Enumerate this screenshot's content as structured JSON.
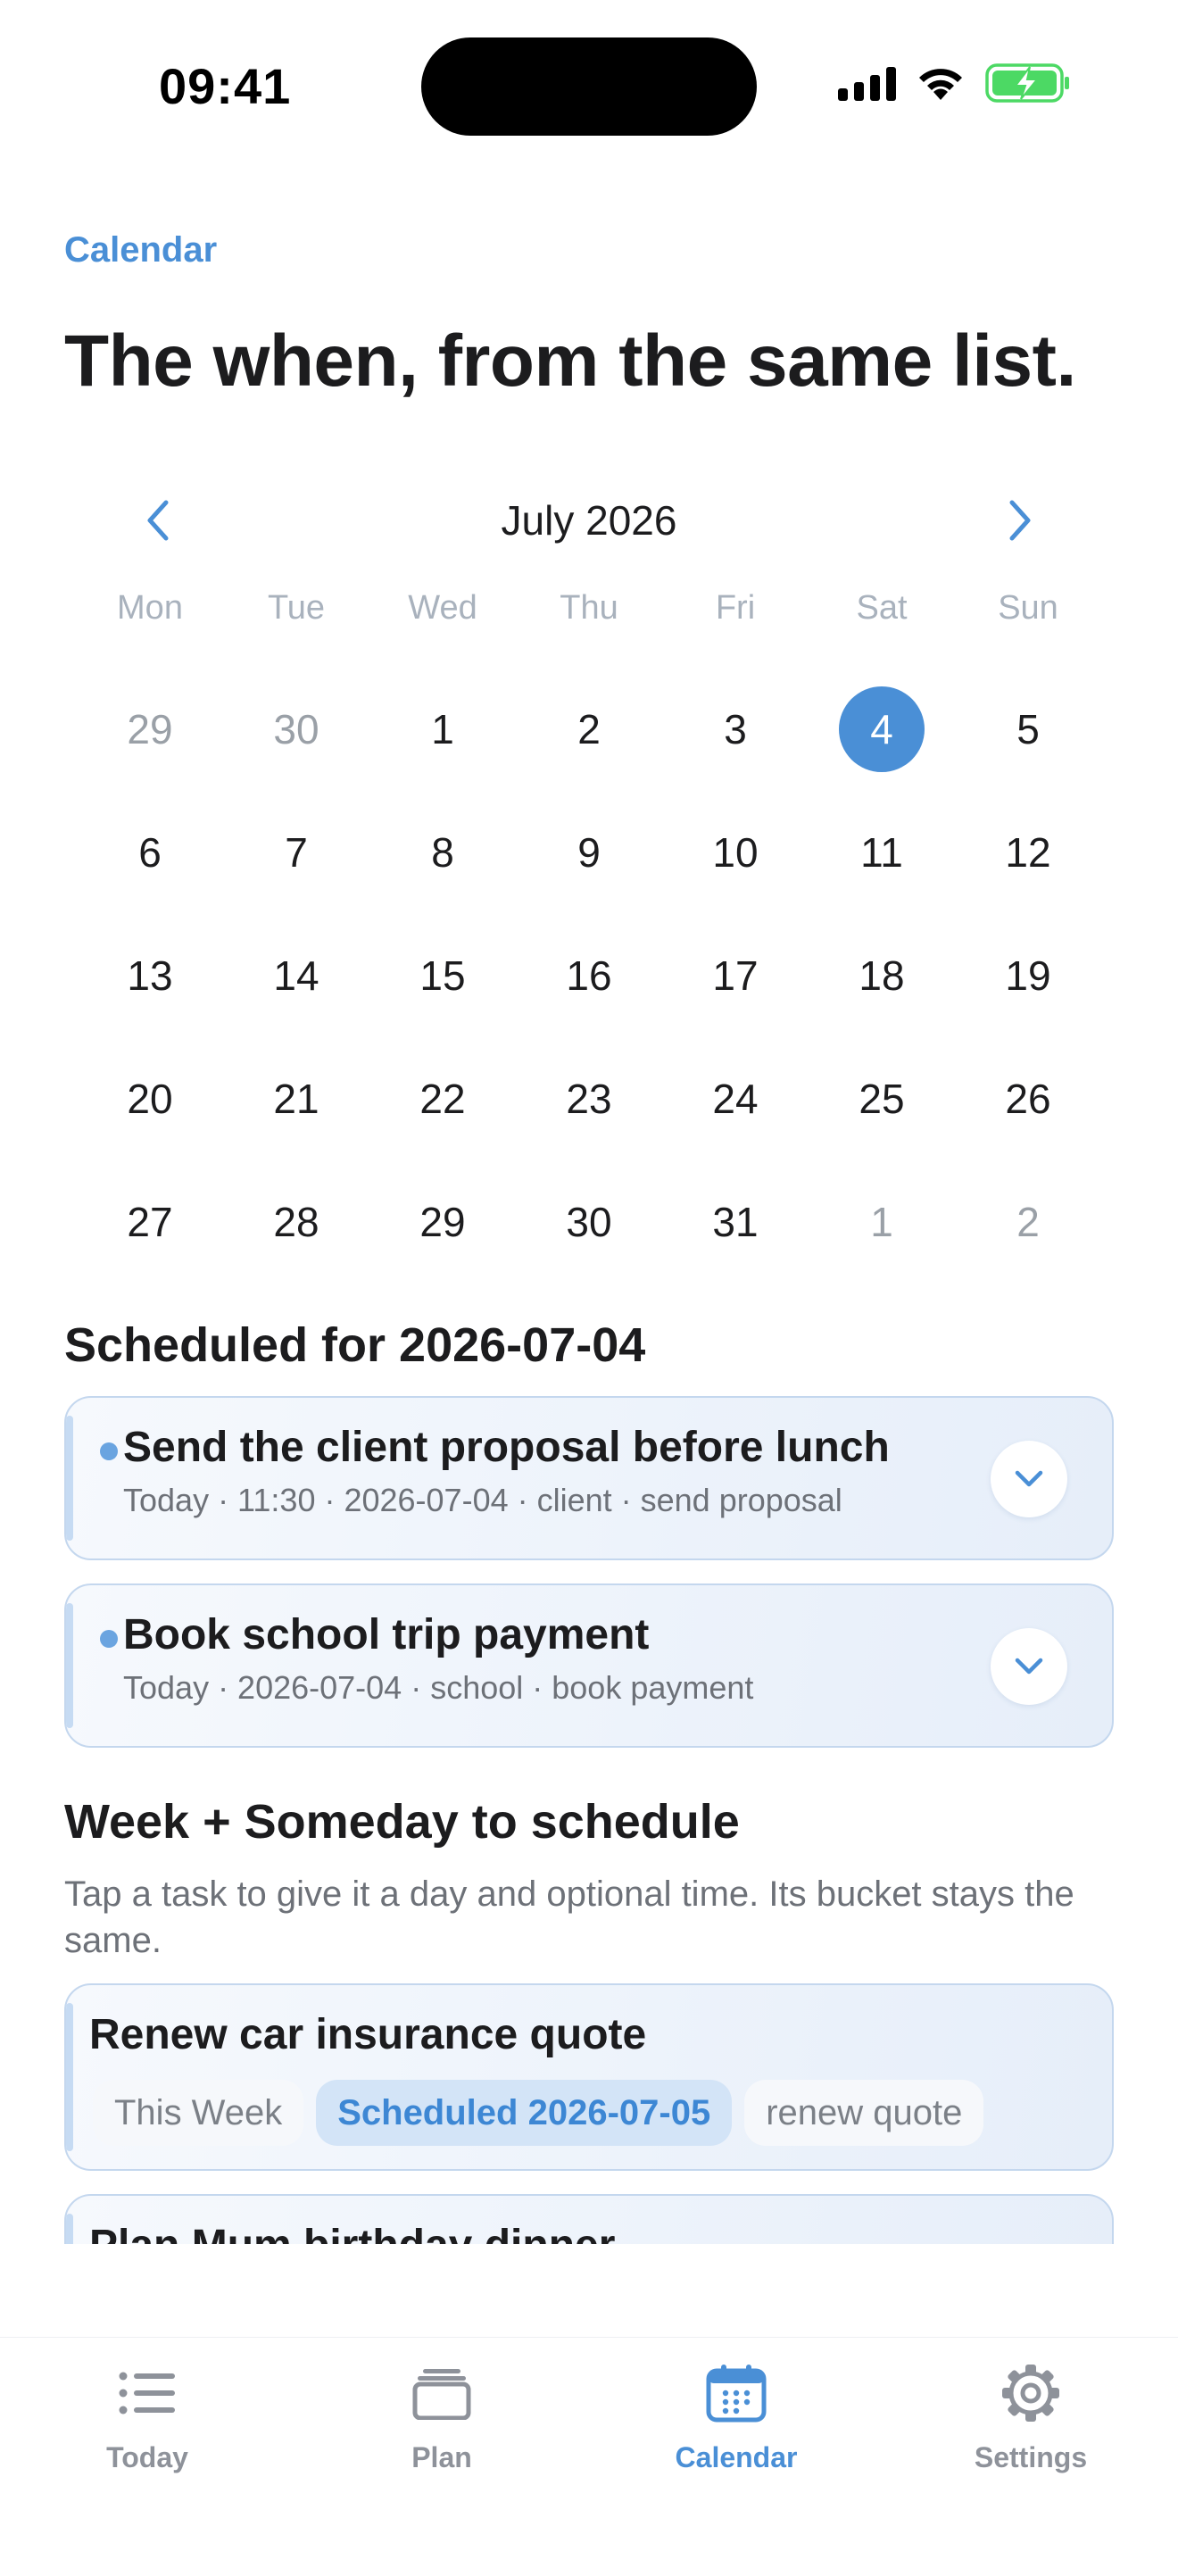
{
  "status": {
    "time": "09:41"
  },
  "header": {
    "eyebrow": "Calendar",
    "title": "The when, from the same list."
  },
  "calendar": {
    "month_label": "July 2026",
    "weekdays": [
      "Mon",
      "Tue",
      "Wed",
      "Thu",
      "Fri",
      "Sat",
      "Sun"
    ],
    "days": [
      {
        "label": "29",
        "muted": true
      },
      {
        "label": "30",
        "muted": true
      },
      {
        "label": "1"
      },
      {
        "label": "2"
      },
      {
        "label": "3"
      },
      {
        "label": "4",
        "selected": true
      },
      {
        "label": "5"
      },
      {
        "label": "6"
      },
      {
        "label": "7"
      },
      {
        "label": "8"
      },
      {
        "label": "9"
      },
      {
        "label": "10"
      },
      {
        "label": "11"
      },
      {
        "label": "12"
      },
      {
        "label": "13"
      },
      {
        "label": "14"
      },
      {
        "label": "15"
      },
      {
        "label": "16"
      },
      {
        "label": "17"
      },
      {
        "label": "18"
      },
      {
        "label": "19"
      },
      {
        "label": "20"
      },
      {
        "label": "21"
      },
      {
        "label": "22"
      },
      {
        "label": "23"
      },
      {
        "label": "24"
      },
      {
        "label": "25"
      },
      {
        "label": "26"
      },
      {
        "label": "27"
      },
      {
        "label": "28"
      },
      {
        "label": "29"
      },
      {
        "label": "30"
      },
      {
        "label": "31"
      },
      {
        "label": "1",
        "muted": true
      },
      {
        "label": "2",
        "muted": true
      }
    ]
  },
  "scheduled": {
    "title": "Scheduled for 2026-07-04",
    "tasks": [
      {
        "title": "Send the client proposal before lunch",
        "meta": "Today · 11:30 · 2026-07-04 · client · send proposal"
      },
      {
        "title": "Book school trip payment",
        "meta": "Today · 2026-07-04 · school · book payment"
      }
    ]
  },
  "to_schedule": {
    "title": "Week + Someday to schedule",
    "description": "Tap a task to give it a day and optional time. Its bucket stays the same.",
    "tasks": [
      {
        "title": "Renew car insurance quote",
        "chips": [
          "This Week",
          "Scheduled 2026-07-05",
          "renew quote"
        ]
      },
      {
        "title": "Plan Mum birthday dinner"
      }
    ]
  },
  "tabs": [
    {
      "label": "Today",
      "icon": "list-icon"
    },
    {
      "label": "Plan",
      "icon": "stack-icon"
    },
    {
      "label": "Calendar",
      "icon": "calendar-icon",
      "active": true
    },
    {
      "label": "Settings",
      "icon": "gear-icon"
    }
  ],
  "colors": {
    "accent": "#4a8fd6",
    "battery": "#4cd964"
  }
}
